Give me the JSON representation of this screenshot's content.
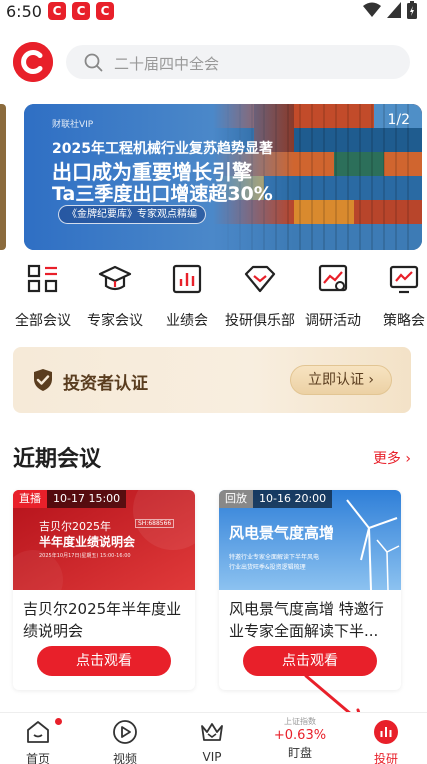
{
  "status_bar": {
    "time": "6:50",
    "app_badge": "C"
  },
  "search": {
    "placeholder": "二十届四中全会"
  },
  "banner": {
    "tag": "财联社VIP",
    "line1": "2025年工程机械行业复苏趋势显著",
    "line2": "出口成为重要增长引擎",
    "line3": "Ta三季度出口增速超30%",
    "pill": "《金牌纪要库》专家观点精编",
    "page": "1/2"
  },
  "categories": [
    {
      "label": "全部会议",
      "icon": "grid-icon"
    },
    {
      "label": "专家会议",
      "icon": "graduation-cap-icon"
    },
    {
      "label": "业绩会",
      "icon": "bar-chart-icon"
    },
    {
      "label": "投研俱乐部",
      "icon": "diamond-icon"
    },
    {
      "label": "调研活动",
      "icon": "chart-search-icon"
    },
    {
      "label": "策略会",
      "icon": "trend-chart-icon"
    }
  ],
  "verify": {
    "title": "投资者认证",
    "button": "立即认证 ›"
  },
  "section": {
    "title": "近期会议",
    "more": "更多 ›"
  },
  "cards": [
    {
      "badge_kind": "直播",
      "badge_time": "10-17 15:00",
      "img_line1": "吉贝尔2025年",
      "img_line2": "半年度业绩说明会",
      "img_code": "SH:688566",
      "img_date": "2025年10月17日(星期五) 15:00-16:00",
      "title": "吉贝尔2025年半年度业绩说明会",
      "button": "点击观看"
    },
    {
      "badge_kind": "回放",
      "badge_time": "10-16 20:00",
      "img_line1": "风电景气度高增",
      "img_line2": "特邀行业专家全面解读下半年风电",
      "img_line3": "行业出货旺季&投资逻辑梳理",
      "title": "风电景气度高增 特邀行业专家全面解读下半...",
      "button": "点击观看"
    }
  ],
  "bottom_nav": [
    {
      "label": "首页",
      "icon": "home-icon"
    },
    {
      "label": "视频",
      "icon": "play-icon"
    },
    {
      "label": "VIP",
      "icon": "crown-icon"
    },
    {
      "label": "盯盘",
      "icon": "index-ticker",
      "sub_label": "上证指数",
      "value": "+0.63%"
    },
    {
      "label": "投研",
      "icon": "research-icon"
    }
  ],
  "colors": {
    "brand_red": "#e8202a",
    "gold_text": "#5a3d1f",
    "up_red": "#e8202a"
  }
}
